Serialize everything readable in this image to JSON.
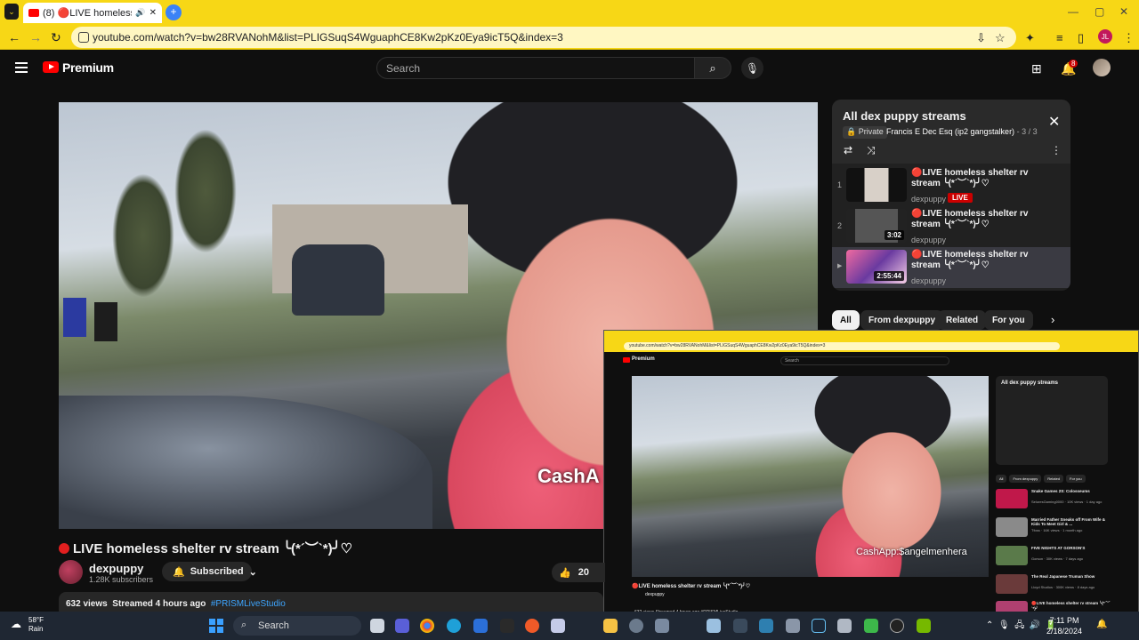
{
  "browser": {
    "tab_title": "(8) 🔴LIVE homeless shelte",
    "url": "youtube.com/watch?v=bw28RVANohM&list=PLIGSuqS4WguaphCE8Kw2pKz0Eya9icT5Q&index=3"
  },
  "header": {
    "brand": "Premium",
    "search_placeholder": "Search",
    "notification_count": "8"
  },
  "video": {
    "watermark": "CashA",
    "title": "LIVE homeless shelter rv stream  ╰(*´︶`*)╯♡",
    "channel": "dexpuppy",
    "subscribers": "1.28K subscribers",
    "subscribe_label": "Subscribed",
    "likes": "20",
    "views": "632 views",
    "streamed": "Streamed 4 hours ago",
    "hashtag": "#PRISMLiveStudio"
  },
  "playlist": {
    "title": "All dex puppy streams",
    "privacy": "Private",
    "owner": "Francis E Dec Esq (ip2 gangstalker)",
    "position": "- 3 / 3",
    "items": [
      {
        "index": "1",
        "title": "🔴LIVE homeless shelter rv stream ╰(*´︶`*)╯♡",
        "channel": "dexpuppy",
        "badge": "LIVE",
        "duration": ""
      },
      {
        "index": "2",
        "title": "🔴LIVE homeless shelter rv stream ╰(*´︶`*)╯♡",
        "channel": "dexpuppy",
        "badge": "",
        "duration": "3:02"
      },
      {
        "index": "▶",
        "title": "🔴LIVE homeless shelter rv stream ╰(*´︶`*)╯♡",
        "channel": "dexpuppy",
        "badge": "",
        "duration": "2:55:44"
      }
    ]
  },
  "chips": [
    "All",
    "From dexpuppy",
    "Related",
    "For you"
  ],
  "overlay": {
    "url": "youtube.com/watch?v=bw28RVANohM&list=PLIGSuqS4WguaphCE8Kw2pKz0Eya9icT5Q&index=3",
    "brand": "Premium",
    "search": "Search",
    "watermark": "CashApp:$angelmenhera",
    "title": "🔴LIVE homeless shelter rv stream ╰(*´︶`*)╯♡",
    "channel": "dexpuppy",
    "views": "632 views  Streamed 4 hours ago  #PRISMLiveStudio",
    "playlist_title": "All dex puppy streams",
    "chips": [
      "All",
      "From dexpuppy",
      "Related",
      "For you"
    ],
    "recs": [
      {
        "title": "Snake Games 2S: Colosseums",
        "sub": "SeluresGaming0000 · 10K views · 1 day ago"
      },
      {
        "title": "Married Father Sneaks off From Wife & Kids To Meet Girl & ...",
        "sub": "Tfoss · 16K views · 1 month ago"
      },
      {
        "title": "FIVE NIGHTS AT GORSON'S",
        "sub": "Gorson · 30K views · 7 days ago"
      },
      {
        "title": "The Real Japanese Truman Show",
        "sub": "Lloyd Studios · 300K views · 8 days ago"
      },
      {
        "title": "🔴LIVE homeless shelter rv stream ╰(*´︶`*)╯",
        "sub": "dexpuppy"
      }
    ]
  },
  "taskbar": {
    "temperature": "58°F",
    "weather": "Rain",
    "search": "Search",
    "time": "7:11 PM",
    "date": "2/18/2024"
  },
  "colors": {
    "accent": "#f7d716",
    "live": "#cc0000",
    "link": "#3ea6ff"
  }
}
